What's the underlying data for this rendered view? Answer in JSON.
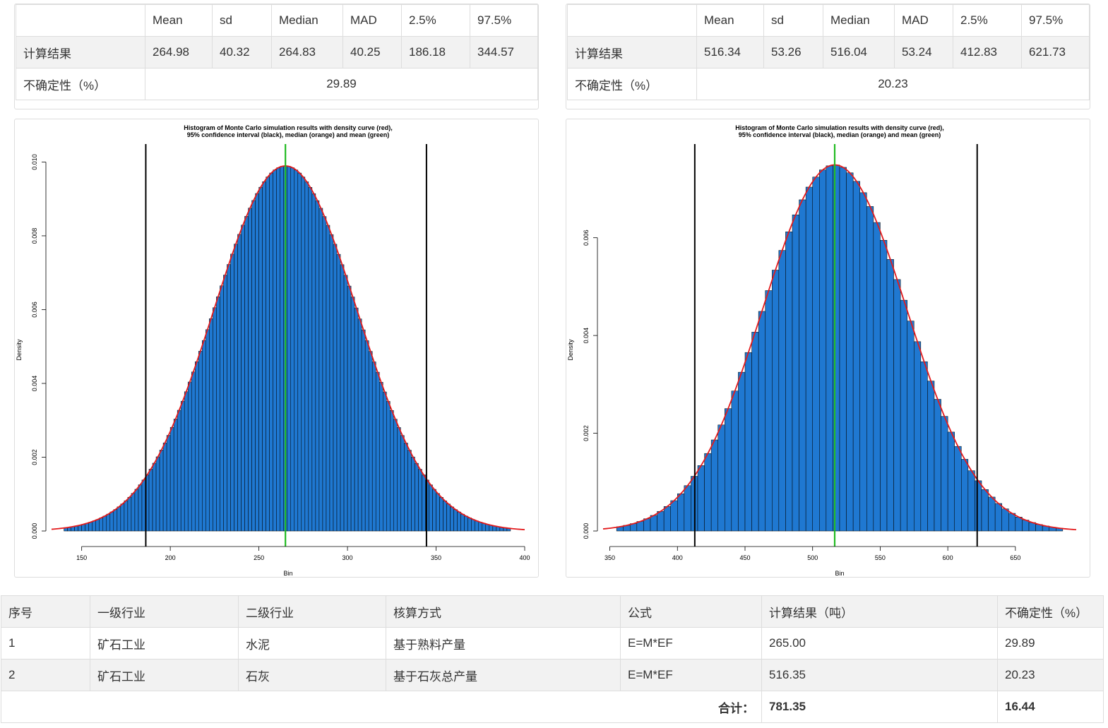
{
  "stats_headers": [
    "",
    "Mean",
    "sd",
    "Median",
    "MAD",
    "2.5%",
    "97.5%"
  ],
  "left_stats": {
    "result_label": "计算结果",
    "values": [
      "264.98",
      "40.32",
      "264.83",
      "40.25",
      "186.18",
      "344.57"
    ],
    "uncertainty_label": "不确定性（%）",
    "uncertainty": "29.89"
  },
  "right_stats": {
    "result_label": "计算结果",
    "values": [
      "516.34",
      "53.26",
      "516.04",
      "53.24",
      "412.83",
      "621.73"
    ],
    "uncertainty_label": "不确定性（%）",
    "uncertainty": "20.23"
  },
  "chart_data": [
    {
      "type": "bar",
      "title": "Histogram of Monte Carlo simulation results with density curve (red),",
      "subtitle": "95% confidence interval (black), median (orange) and mean (green)",
      "xlabel": "Bin",
      "ylabel": "Density",
      "xlim": [
        133,
        400
      ],
      "ylim": [
        0,
        0.0102
      ],
      "xticks": [
        150,
        200,
        250,
        300,
        350,
        400
      ],
      "yticks": [
        "0.000",
        "0.002",
        "0.004",
        "0.006",
        "0.008",
        "0.010"
      ],
      "distribution": {
        "mean": 264.98,
        "sd": 40.32,
        "min": 140,
        "max": 392,
        "bin_width": 2
      },
      "bar_color": "#1f78d1",
      "density_color": "#e31a1c",
      "ci_lines": [
        186.18,
        344.57
      ],
      "ci_color": "#000000",
      "mean_line": 264.98,
      "mean_color": "#22bb22"
    },
    {
      "type": "bar",
      "title": "Histogram of Monte Carlo simulation results with density curve (red),",
      "subtitle": "95% confidence interval (black), median (orange) and mean (green)",
      "xlabel": "Bin",
      "ylabel": "Density",
      "xlim": [
        345,
        695
      ],
      "ylim": [
        0,
        0.0077
      ],
      "xticks": [
        350,
        400,
        450,
        500,
        550,
        600,
        650
      ],
      "yticks": [
        "0.000",
        "0.002",
        "0.004",
        "0.006"
      ],
      "distribution": {
        "mean": 516.34,
        "sd": 53.26,
        "min": 355,
        "max": 685,
        "bin_width": 5
      },
      "bar_color": "#1f78d1",
      "density_color": "#e31a1c",
      "ci_lines": [
        412.83,
        621.73
      ],
      "ci_color": "#000000",
      "mean_line": 516.34,
      "mean_color": "#22bb22"
    }
  ],
  "summary": {
    "headers": [
      "序号",
      "一级行业",
      "二级行业",
      "核算方式",
      "公式",
      "计算结果（吨）",
      "不确定性（%）"
    ],
    "rows": [
      [
        "1",
        "矿石工业",
        "水泥",
        "基于熟料产量",
        "E=M*EF",
        "265.00",
        "29.89"
      ],
      [
        "2",
        "矿石工业",
        "石灰",
        "基于石灰总产量",
        "E=M*EF",
        "516.35",
        "20.23"
      ]
    ],
    "total_label": "合计：",
    "total_result": "781.35",
    "total_uncertainty": "16.44"
  }
}
